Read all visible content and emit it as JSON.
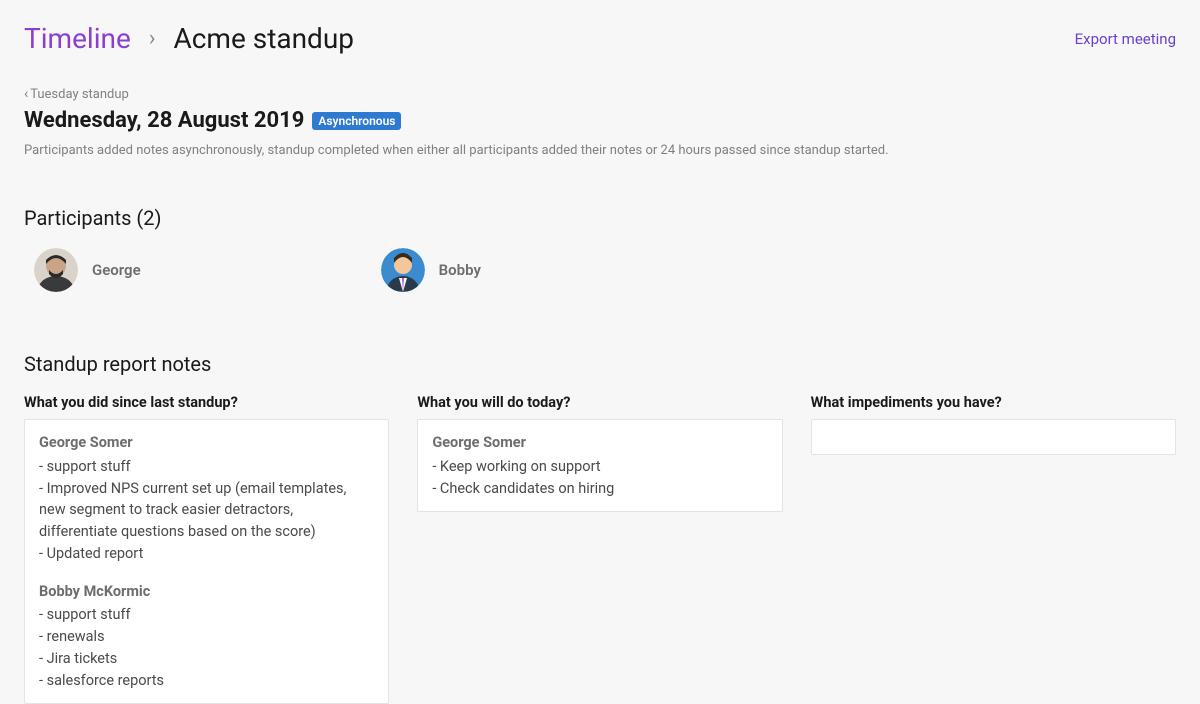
{
  "header": {
    "timeline_label": "Timeline",
    "current": "Acme standup",
    "export_label": "Export meeting"
  },
  "back": {
    "label": "Tuesday standup"
  },
  "date": "Wednesday, 28 August 2019",
  "badge": "Asynchronous",
  "description": "Participants added notes asynchronously, standup completed when either all participants added their notes or 24 hours passed since standup started.",
  "participants": {
    "title": "Participants (2)",
    "items": [
      {
        "name": "George"
      },
      {
        "name": "Bobby"
      }
    ]
  },
  "notes": {
    "title": "Standup report notes",
    "columns": [
      {
        "heading": "What you did since last standup?",
        "entries": [
          {
            "author": "George Somer",
            "lines": [
              "- support stuff",
              "- Improved NPS current set up (email templates, new segment to track easier detractors, differentiate questions based on the score)",
              "- Updated report"
            ]
          },
          {
            "author": "Bobby McKormic",
            "lines": [
              "- support stuff",
              "- renewals",
              "- Jira tickets",
              "- salesforce reports"
            ]
          }
        ]
      },
      {
        "heading": "What you will do today?",
        "entries": [
          {
            "author": "George Somer",
            "lines": [
              "- Keep working on support",
              "- Check candidates on hiring"
            ]
          }
        ]
      },
      {
        "heading": "What impediments you have?",
        "entries": []
      }
    ]
  }
}
